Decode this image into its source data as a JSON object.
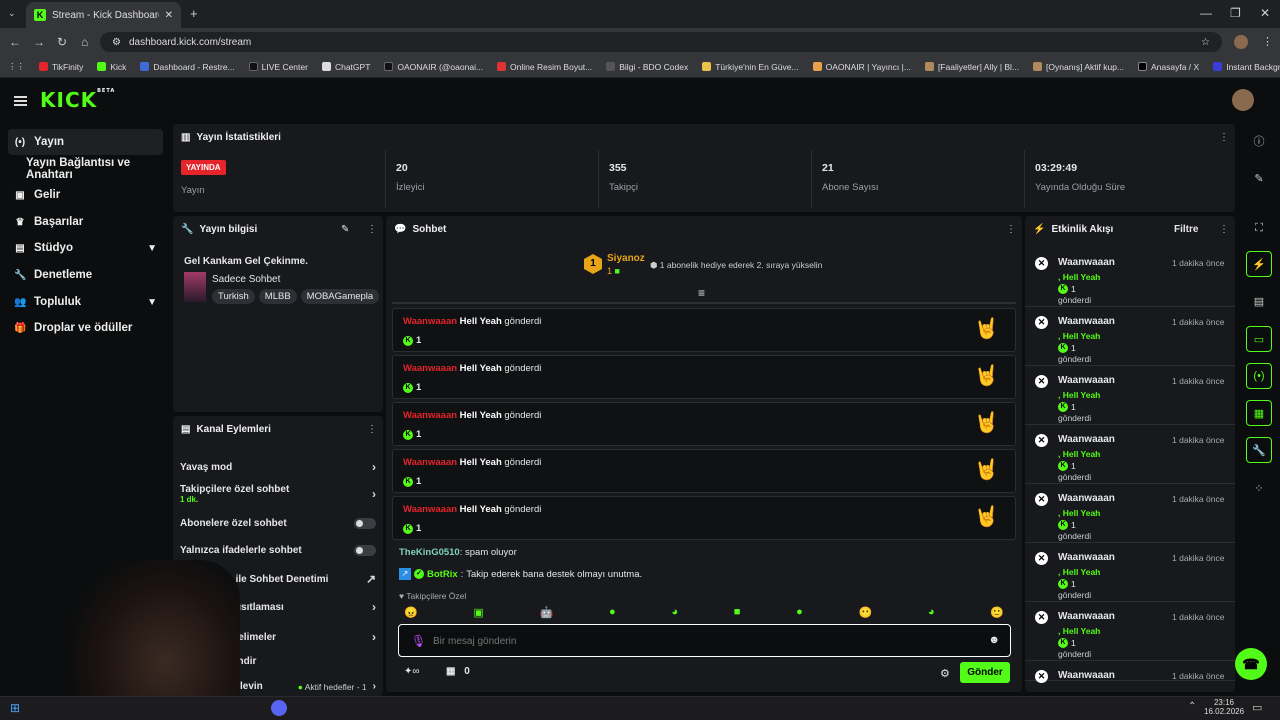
{
  "browser": {
    "tab_title": "Stream - Kick Dashboard",
    "url": "dashboard.kick.com/stream",
    "bookmarks": [
      "TikFinity",
      "Kick",
      "Dashboard - Restre...",
      "LIVE Center",
      "ChatGPT",
      "OAONAIR (@oaonai...",
      "Online Resim Boyut...",
      "Bilgi - BDO Codex",
      "Türkiye'nin En Güve...",
      "OAONAIR | Yayıncı |...",
      "[Faaliyetler] Ally | Bl...",
      "[Oynanış] Aktif kup...",
      "Anasayfa / X",
      "Instant Background..."
    ]
  },
  "header": {
    "logo": "KICK",
    "logo_beta": "BETA"
  },
  "sidebar": {
    "items": [
      {
        "label": "Yayın",
        "icon": "broadcast-icon"
      },
      {
        "label": "Yayın Bağlantısı ve Anahtarı"
      },
      {
        "label": "Gelir",
        "icon": "revenue-icon"
      },
      {
        "label": "Başarılar",
        "icon": "trophy-icon"
      },
      {
        "label": "Stüdyo",
        "icon": "studio-icon"
      },
      {
        "label": "Denetleme",
        "icon": "wrench-icon"
      },
      {
        "label": "Topluluk",
        "icon": "community-icon"
      },
      {
        "label": "Droplar ve ödüller",
        "icon": "gift-icon"
      }
    ]
  },
  "stats": {
    "title": "Yayın İstatistikleri",
    "badge": "YAYINDA",
    "status_label": "Yayın",
    "viewers": "20",
    "viewers_label": "İzleyici",
    "followers": "355",
    "followers_label": "Takipçi",
    "subs": "21",
    "subs_label": "Abone Sayısı",
    "uptime": "03:29:49",
    "uptime_label": "Yayında Olduğu Süre"
  },
  "info": {
    "title": "Yayın bilgisi",
    "stream_title": "Gel Kankam Gel Çekinme.",
    "category": "Sadece Sohbet",
    "tags": [
      "Turkish",
      "MLBB",
      "MOBAGamepla"
    ]
  },
  "actions": {
    "title": "Kanal Eylemleri",
    "slow": "Yavaş mod",
    "followers_only": "Takipçilere özel sohbet",
    "followers_only_sub": "1 dk.",
    "subs_only": "Abonelere özel sohbet",
    "emotes_only": "Yalnızca ifadelerle sohbet",
    "ai_mod": "Zeka ile Sohbet Denetimi",
    "limit": "aşı kısıtlaması",
    "words": "aış kelimeler",
    "extra1": "endir",
    "extra2": "levin",
    "goals": "Aktif hedefler - 1"
  },
  "chat": {
    "title": "Sohbet",
    "pinned_user": "Siyanoz",
    "pinned_rank": "1",
    "pinned_count": "1",
    "pinned_text": "1 abonelik hediye ederek 2. sıraya yükselin",
    "gift_sender": "Waanwaaan",
    "gift_item": "Hell Yeah",
    "gift_verb": "gönderdi",
    "gift_count": "1",
    "m1_user": "TheKinG0510",
    "m1_text": "spam oluyor",
    "m2_user": "BotRix",
    "m2_text": "Takip ederek bana destek olmayı unutma.",
    "followers_only_label": "Takipçilere Özel",
    "placeholder": "Bir mesaj gönderin",
    "points": "0",
    "send": "Gönder"
  },
  "events": {
    "title": "Etkinlik Akışı",
    "filter": "Filtre",
    "user": "Waanwaaan",
    "time": "1 dakika önce",
    "gift": "Hell Yeah",
    "count": "1",
    "verb": "gönderdi"
  },
  "taskbar": {
    "time": "23:16",
    "date": "16.02.2026"
  },
  "colors": {
    "accent": "#53fc18",
    "live": "#e5242b"
  }
}
